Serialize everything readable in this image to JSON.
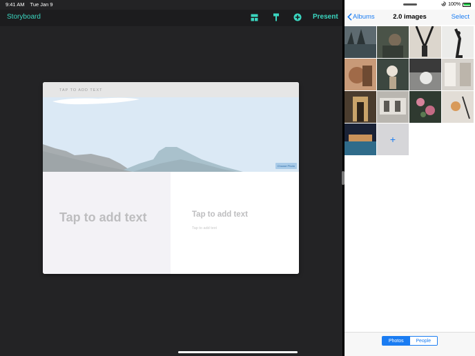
{
  "status_left": {
    "time": "9:41 AM",
    "date": "Tue Jan 9"
  },
  "status_right": {
    "battery": "100%"
  },
  "storyboard_app": {
    "back_label": "Storyboard",
    "present_label": "Present",
    "icons": [
      "layout-icon",
      "brush-icon",
      "add-circle-icon"
    ],
    "accent": "#3ad6c0"
  },
  "card": {
    "top_placeholder": "TAP TO ADD TEXT",
    "choose_photo": "Choose Photo",
    "left_placeholder": "Tap to add text",
    "right_title": "Tap to add text",
    "right_subtitle": "Tap to add text"
  },
  "photos_app": {
    "back_label": "Albums",
    "title": "2.0 images",
    "select_label": "Select",
    "add_tile_symbol": "+",
    "segments": [
      "Photos",
      "People"
    ],
    "active_segment": "Photos",
    "accent": "#1a7cf2"
  }
}
